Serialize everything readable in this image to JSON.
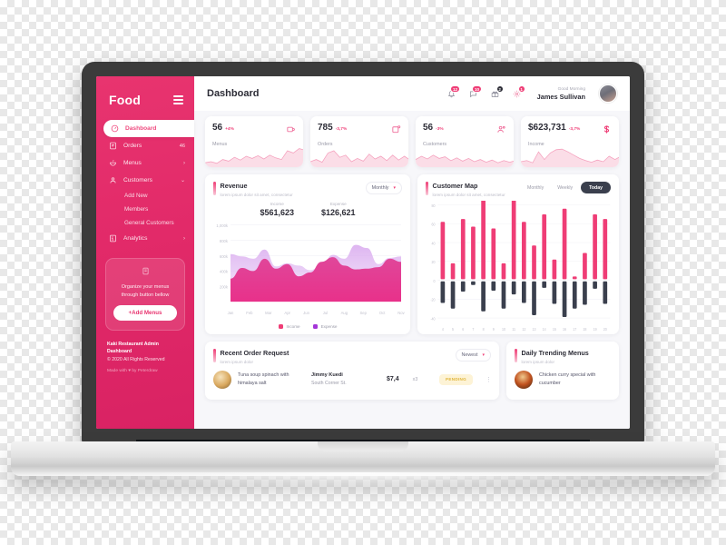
{
  "sidebar": {
    "brand": "Food",
    "menu_icon": "hamburger-icon",
    "items": [
      {
        "label": "Dashboard",
        "icon": "gauge-icon",
        "active": true,
        "badge": "",
        "arrow": ""
      },
      {
        "label": "Orders",
        "icon": "clipboard-icon",
        "active": false,
        "badge": "46",
        "arrow": ""
      },
      {
        "label": "Menus",
        "icon": "bowl-icon",
        "active": false,
        "badge": "",
        "arrow": "›"
      },
      {
        "label": "Customers",
        "icon": "user-icon",
        "active": false,
        "badge": "",
        "arrow": "⌄"
      }
    ],
    "sub_items": [
      "Add New",
      "Members",
      "General Customers"
    ],
    "analytics": {
      "label": "Analytics",
      "icon": "chart-icon",
      "arrow": "›"
    },
    "promo": {
      "icon": "menu-book-icon",
      "text": "Organize your menus through button bellow",
      "button": "+Add Menus"
    },
    "footer": {
      "line1": "Kaki Restaurant Admin Dashboard",
      "line2": "© 2020 All Rights Reserved",
      "line3": "Made with ♥ by Peterdraw"
    }
  },
  "topbar": {
    "title": "Dashboard",
    "icons": [
      {
        "name": "bell-icon",
        "badge": "12",
        "badge_color": "#ef3d76"
      },
      {
        "name": "message-icon",
        "badge": "10",
        "badge_color": "#ef3d76"
      },
      {
        "name": "gift-icon",
        "badge": "2",
        "badge_color": "#2c2c36"
      },
      {
        "name": "settings-icon",
        "badge": "1",
        "badge_color": "#ef3d76"
      }
    ],
    "greeting": "Good Morning",
    "user_name": "James Sullivan",
    "avatar": "user-avatar"
  },
  "stats": [
    {
      "value": "56",
      "delta": "+4%",
      "delta_color": "#ef3d76",
      "label": "Menus",
      "icon": "coffee-cup-icon"
    },
    {
      "value": "785",
      "delta": "-3,7%",
      "delta_color": "#ef3d76",
      "label": "Orders",
      "icon": "order-box-icon"
    },
    {
      "value": "56",
      "delta": "-3%",
      "delta_color": "#ef3d76",
      "label": "Customers",
      "icon": "customers-icon"
    },
    {
      "value": "$623,731",
      "delta": "-3,7%",
      "delta_color": "#ef3d76",
      "label": "Income",
      "icon": "dollar-icon"
    }
  ],
  "revenue": {
    "title": "Revenue",
    "subtitle": "lorem ipsum dolor sit amet, consectetur",
    "range_label": "Monthly",
    "income_label": "Income",
    "income_value": "$561,623",
    "expense_label": "Expense",
    "expense_value": "$126,621",
    "legend": [
      {
        "label": "Income",
        "color": "#ef3d76"
      },
      {
        "label": "Expense",
        "color": "#a435d8"
      }
    ]
  },
  "customer_map": {
    "title": "Customer Map",
    "subtitle": "lorem ipsum dolor sit amet, consectetur",
    "ranges": [
      {
        "label": "Monthly",
        "active": false
      },
      {
        "label": "Weekly",
        "active": false
      },
      {
        "label": "Today",
        "active": true
      }
    ]
  },
  "orders": {
    "title": "Recent Order Request",
    "subtitle": "lorem ipsum dolor",
    "sort_label": "Newest",
    "rows": [
      {
        "thumb": "tuna-soup-thumb",
        "item": "Tuna soup spinach with himalaya salt",
        "customer": "Jimmy Kuedi",
        "address": "South Corner St.",
        "price": "$7,4",
        "qty": "x3",
        "status": "PENDING",
        "menu_icon": "kebab-menu-icon"
      }
    ]
  },
  "trending": {
    "title": "Daily Trending Menus",
    "subtitle": "lorem ipsum dolor",
    "rows": [
      {
        "thumb": "chicken-curry-thumb",
        "item": "Chicken curry special with cucumber"
      }
    ]
  },
  "chart_data": [
    {
      "type": "area",
      "title": "Revenue",
      "xlabel": "",
      "ylabel": "",
      "categories": [
        "Jan",
        "Feb",
        "Mar",
        "Apr",
        "Jun",
        "Jul",
        "Aug",
        "Sep",
        "Oct",
        "Nov"
      ],
      "ytick_labels": [
        "1,000k",
        "800k",
        "600k",
        "400k",
        "200k"
      ],
      "ylim": [
        0,
        1000
      ],
      "grid": true,
      "legend_position": "bottom",
      "series": [
        {
          "name": "Income",
          "color": "#ef3d76",
          "values": [
            300,
            440,
            400,
            560,
            430,
            490,
            330,
            380,
            520,
            580,
            470,
            420,
            430,
            450,
            560,
            520
          ]
        },
        {
          "name": "Expense",
          "color": "#a435d8",
          "values": [
            620,
            590,
            560,
            680,
            460,
            500,
            470,
            410,
            470,
            610,
            560,
            740,
            700,
            490,
            570,
            590
          ]
        }
      ]
    },
    {
      "type": "bar",
      "title": "Customer Map",
      "xlabel": "",
      "ylabel": "",
      "categories": [
        "4",
        "5",
        "6",
        "7",
        "8",
        "9",
        "10",
        "11",
        "12",
        "13",
        "14",
        "15",
        "16",
        "17",
        "18",
        "19",
        "20"
      ],
      "ytick_labels": [
        "80",
        "60",
        "40",
        "20",
        "0",
        "-20",
        "-40"
      ],
      "ylim": [
        -40,
        80
      ],
      "grid": true,
      "series": [
        {
          "name": "Positive",
          "color": "#ef3d76",
          "values": [
            62,
            18,
            65,
            57,
            86,
            55,
            18,
            85,
            62,
            37,
            70,
            22,
            76,
            4,
            29,
            70,
            65
          ]
        },
        {
          "name": "Negative",
          "color": "#3a3f4d",
          "values": [
            -24,
            -30,
            -12,
            -5,
            -33,
            -11,
            -30,
            -15,
            -24,
            -37,
            -8,
            -25,
            -39,
            -30,
            -26,
            -9,
            -25
          ]
        }
      ]
    }
  ]
}
